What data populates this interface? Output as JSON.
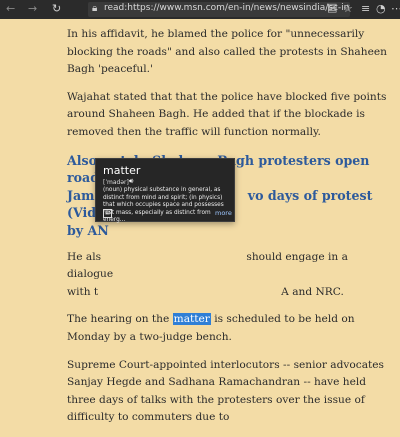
{
  "browser": {
    "url": "read:https://www.msn.com/en-in/news/newsindia/sc-interlocutor-wajahat-h",
    "icons": [
      "back-icon",
      "forward-icon",
      "refresh-icon",
      "reading-view-icon",
      "favorite-star-icon",
      "favorites-bar-icon",
      "profile-icon",
      "more-menu-icon"
    ]
  },
  "article": {
    "p1": "In his affidavit, he blamed the police for \"unnecessarily blocking the roads\" and also called the protests in Shaheen Bagh 'peaceful.'",
    "p2": "Wajahat stated that that the police have blocked five points around Shaheen Bagh. He added that if the blockade is removed then the traffic will function normally.",
    "h3_a": "Also watch: Shaheen Bagh protesters open road from",
    "h3_b": "Jamia ",
    "h3_c": "vo days of protest (Video",
    "h3_d": "by AN",
    "p4_a": "He als",
    "p4_b": " should engage in a dialogue",
    "p4_c": "with t",
    "p4_d": "A and NRC.",
    "p5_a": "The hearing on the ",
    "p5_word": "matter",
    "p5_b": " is scheduled to be held on Monday by a two-judge bench.",
    "p6": "Supreme Court-appointed interlocutors -- senior advocates Sanjay Hegde and Sadhana Ramachandran -- have held three days of talks with the protesters over the issue of difficulty to commuters due to"
  },
  "dictionary": {
    "word": "matter",
    "pronunciation": "[ˈmadər]",
    "definition": "(noun) physical substance in general, as\ndistinct from mind and spirit; (in physics)\nthat which occupies space and possesses\nrest mass, especially as distinct from energ...",
    "more": "more"
  },
  "colors": {
    "page_bg": "#f3dca6",
    "heading": "#2d5a9c",
    "highlight": "#2f7fd6",
    "toolbar": "#2b2b2b",
    "popup_bg": "#262626"
  }
}
